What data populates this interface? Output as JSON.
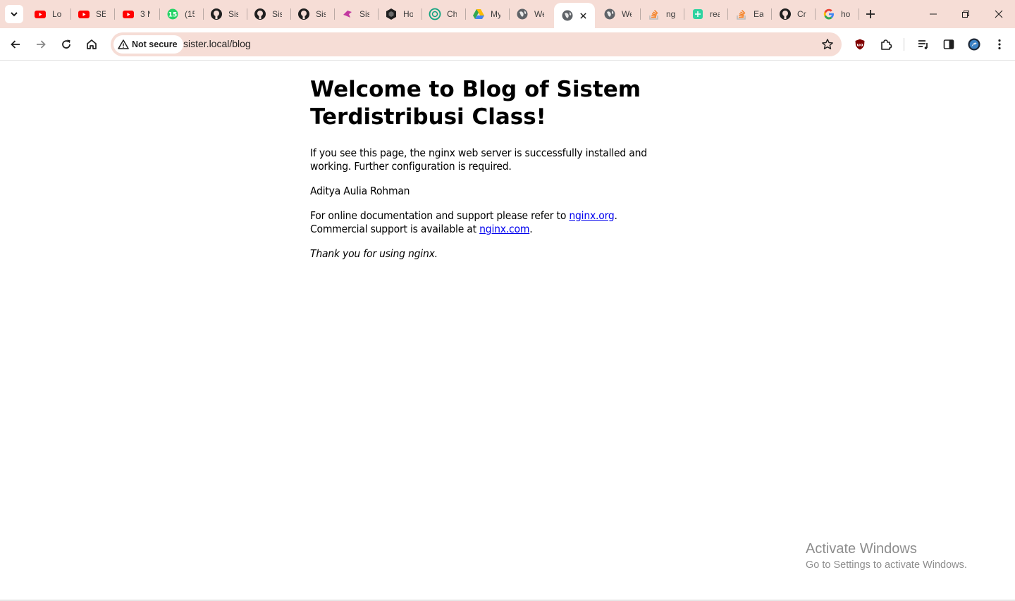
{
  "browser": {
    "tabs": [
      {
        "label": "Lo",
        "icon": "youtube-icon"
      },
      {
        "label": "SE",
        "icon": "youtube-icon"
      },
      {
        "label": "3 N",
        "icon": "youtube-icon"
      },
      {
        "label": "(15",
        "icon": "whatsapp-icon"
      },
      {
        "label": "Sis",
        "icon": "github-icon"
      },
      {
        "label": "Sis",
        "icon": "github-icon"
      },
      {
        "label": "Sis",
        "icon": "github-icon"
      },
      {
        "label": "Sis",
        "icon": "bird-icon"
      },
      {
        "label": "Ho",
        "icon": "hex-icon"
      },
      {
        "label": "Ch",
        "icon": "chatgpt-icon"
      },
      {
        "label": "My",
        "icon": "drive-icon"
      },
      {
        "label": "We",
        "icon": "globe-icon"
      },
      {
        "label": "",
        "icon": "globe-icon",
        "active": true
      },
      {
        "label": "We",
        "icon": "globe-icon"
      },
      {
        "label": "ng",
        "icon": "stackoverflow-icon"
      },
      {
        "label": "rea",
        "icon": "app-icon"
      },
      {
        "label": "Ea",
        "icon": "stackoverflow-icon"
      },
      {
        "label": "Cr",
        "icon": "github-icon"
      },
      {
        "label": "ho",
        "icon": "google-icon"
      }
    ],
    "security_chip": "Not secure",
    "url": "sister.local/blog"
  },
  "page": {
    "heading": "Welcome to Blog of Sistem Terdistribusi Class!",
    "intro": "If you see this page, the nginx web server is successfully installed and working. Further configuration is required.",
    "author": "Aditya Aulia Rohman",
    "doc_prefix": "For online documentation and support please refer to ",
    "doc_link": "nginx.org",
    "doc_suffix": ".",
    "commercial_prefix": "Commercial support is available at ",
    "commercial_link": "nginx.com",
    "commercial_suffix": ".",
    "thanks": "Thank you for using nginx."
  },
  "watermark": {
    "title": "Activate Windows",
    "subtitle": "Go to Settings to activate Windows."
  },
  "colors": {
    "chrome_bg": "#f6ddd6",
    "link": "#0000ee"
  }
}
